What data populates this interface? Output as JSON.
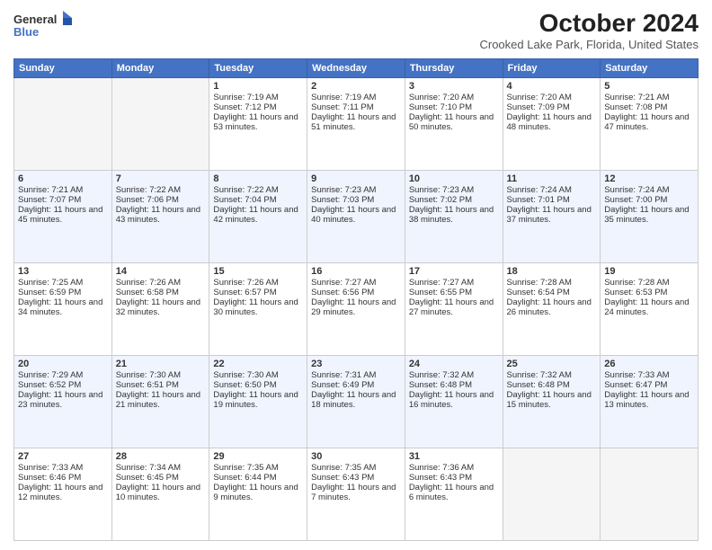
{
  "header": {
    "logo_line1": "General",
    "logo_line2": "Blue",
    "month_title": "October 2024",
    "location": "Crooked Lake Park, Florida, United States"
  },
  "days_of_week": [
    "Sunday",
    "Monday",
    "Tuesday",
    "Wednesday",
    "Thursday",
    "Friday",
    "Saturday"
  ],
  "weeks": [
    [
      {
        "day": "",
        "info": ""
      },
      {
        "day": "",
        "info": ""
      },
      {
        "day": "1",
        "info": "Sunrise: 7:19 AM\nSunset: 7:12 PM\nDaylight: 11 hours and 53 minutes."
      },
      {
        "day": "2",
        "info": "Sunrise: 7:19 AM\nSunset: 7:11 PM\nDaylight: 11 hours and 51 minutes."
      },
      {
        "day": "3",
        "info": "Sunrise: 7:20 AM\nSunset: 7:10 PM\nDaylight: 11 hours and 50 minutes."
      },
      {
        "day": "4",
        "info": "Sunrise: 7:20 AM\nSunset: 7:09 PM\nDaylight: 11 hours and 48 minutes."
      },
      {
        "day": "5",
        "info": "Sunrise: 7:21 AM\nSunset: 7:08 PM\nDaylight: 11 hours and 47 minutes."
      }
    ],
    [
      {
        "day": "6",
        "info": "Sunrise: 7:21 AM\nSunset: 7:07 PM\nDaylight: 11 hours and 45 minutes."
      },
      {
        "day": "7",
        "info": "Sunrise: 7:22 AM\nSunset: 7:06 PM\nDaylight: 11 hours and 43 minutes."
      },
      {
        "day": "8",
        "info": "Sunrise: 7:22 AM\nSunset: 7:04 PM\nDaylight: 11 hours and 42 minutes."
      },
      {
        "day": "9",
        "info": "Sunrise: 7:23 AM\nSunset: 7:03 PM\nDaylight: 11 hours and 40 minutes."
      },
      {
        "day": "10",
        "info": "Sunrise: 7:23 AM\nSunset: 7:02 PM\nDaylight: 11 hours and 38 minutes."
      },
      {
        "day": "11",
        "info": "Sunrise: 7:24 AM\nSunset: 7:01 PM\nDaylight: 11 hours and 37 minutes."
      },
      {
        "day": "12",
        "info": "Sunrise: 7:24 AM\nSunset: 7:00 PM\nDaylight: 11 hours and 35 minutes."
      }
    ],
    [
      {
        "day": "13",
        "info": "Sunrise: 7:25 AM\nSunset: 6:59 PM\nDaylight: 11 hours and 34 minutes."
      },
      {
        "day": "14",
        "info": "Sunrise: 7:26 AM\nSunset: 6:58 PM\nDaylight: 11 hours and 32 minutes."
      },
      {
        "day": "15",
        "info": "Sunrise: 7:26 AM\nSunset: 6:57 PM\nDaylight: 11 hours and 30 minutes."
      },
      {
        "day": "16",
        "info": "Sunrise: 7:27 AM\nSunset: 6:56 PM\nDaylight: 11 hours and 29 minutes."
      },
      {
        "day": "17",
        "info": "Sunrise: 7:27 AM\nSunset: 6:55 PM\nDaylight: 11 hours and 27 minutes."
      },
      {
        "day": "18",
        "info": "Sunrise: 7:28 AM\nSunset: 6:54 PM\nDaylight: 11 hours and 26 minutes."
      },
      {
        "day": "19",
        "info": "Sunrise: 7:28 AM\nSunset: 6:53 PM\nDaylight: 11 hours and 24 minutes."
      }
    ],
    [
      {
        "day": "20",
        "info": "Sunrise: 7:29 AM\nSunset: 6:52 PM\nDaylight: 11 hours and 23 minutes."
      },
      {
        "day": "21",
        "info": "Sunrise: 7:30 AM\nSunset: 6:51 PM\nDaylight: 11 hours and 21 minutes."
      },
      {
        "day": "22",
        "info": "Sunrise: 7:30 AM\nSunset: 6:50 PM\nDaylight: 11 hours and 19 minutes."
      },
      {
        "day": "23",
        "info": "Sunrise: 7:31 AM\nSunset: 6:49 PM\nDaylight: 11 hours and 18 minutes."
      },
      {
        "day": "24",
        "info": "Sunrise: 7:32 AM\nSunset: 6:48 PM\nDaylight: 11 hours and 16 minutes."
      },
      {
        "day": "25",
        "info": "Sunrise: 7:32 AM\nSunset: 6:48 PM\nDaylight: 11 hours and 15 minutes."
      },
      {
        "day": "26",
        "info": "Sunrise: 7:33 AM\nSunset: 6:47 PM\nDaylight: 11 hours and 13 minutes."
      }
    ],
    [
      {
        "day": "27",
        "info": "Sunrise: 7:33 AM\nSunset: 6:46 PM\nDaylight: 11 hours and 12 minutes."
      },
      {
        "day": "28",
        "info": "Sunrise: 7:34 AM\nSunset: 6:45 PM\nDaylight: 11 hours and 10 minutes."
      },
      {
        "day": "29",
        "info": "Sunrise: 7:35 AM\nSunset: 6:44 PM\nDaylight: 11 hours and 9 minutes."
      },
      {
        "day": "30",
        "info": "Sunrise: 7:35 AM\nSunset: 6:43 PM\nDaylight: 11 hours and 7 minutes."
      },
      {
        "day": "31",
        "info": "Sunrise: 7:36 AM\nSunset: 6:43 PM\nDaylight: 11 hours and 6 minutes."
      },
      {
        "day": "",
        "info": ""
      },
      {
        "day": "",
        "info": ""
      }
    ]
  ]
}
